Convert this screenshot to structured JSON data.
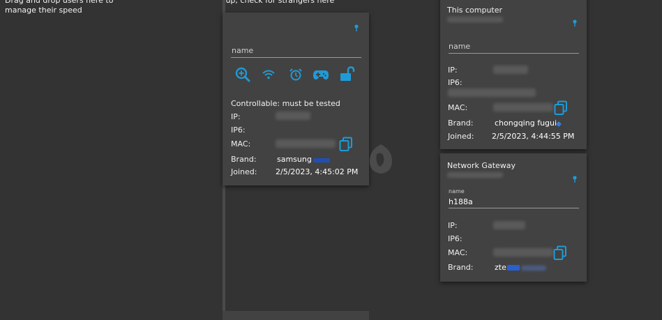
{
  "columns": {
    "left_hint": "Drag and drop users here to manage their speed",
    "middle_hint": "Yup, check for strangers here"
  },
  "card_unknown": {
    "name_placeholder": "name",
    "status": "Controllable: must be tested",
    "ip_label": "IP:",
    "ip6_label": "IP6:",
    "mac_label": "MAC:",
    "brand_label": "Brand:",
    "brand_value": "samsung",
    "joined_label": "Joined:",
    "joined_value": "2/5/2023, 4:45:02 PM",
    "actions": [
      "zoom-in-icon",
      "wifi-icon",
      "alarm-icon",
      "gamepad-icon",
      "unlock-icon"
    ]
  },
  "card_this_computer": {
    "title": "This computer",
    "name_placeholder": "name",
    "ip_label": "IP:",
    "ip6_label": "IP6:",
    "mac_label": "MAC:",
    "brand_label": "Brand:",
    "brand_value": "chongqing fugui",
    "joined_label": "Joined:",
    "joined_value": "2/5/2023, 4:44:55 PM"
  },
  "card_gateway": {
    "title": "Network Gateway",
    "name_label": "name",
    "name_value": "h188a",
    "ip_label": "IP:",
    "ip6_label": "IP6:",
    "mac_label": "MAC:",
    "brand_label": "Brand:",
    "brand_value": "zte"
  },
  "colors": {
    "accent": "#1e9bd7",
    "background": "#333333",
    "card": "#424242"
  }
}
